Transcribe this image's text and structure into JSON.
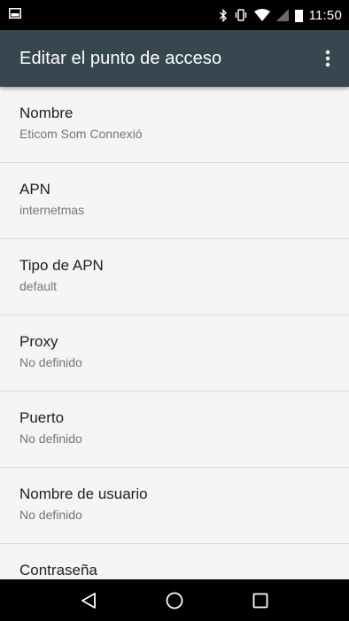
{
  "status_bar": {
    "time": "11:50",
    "icons": [
      "screenshot-icon",
      "bluetooth-icon",
      "vibrate-icon",
      "wifi-icon",
      "signal-icon",
      "battery-icon"
    ]
  },
  "app_bar": {
    "title": "Editar el punto de acceso",
    "overflow_icon": "more-vert-icon",
    "color": "#37474f"
  },
  "settings": {
    "items": [
      {
        "title": "Nombre",
        "summary": "Eticom Som Connexió"
      },
      {
        "title": "APN",
        "summary": "internetmas"
      },
      {
        "title": "Tipo de APN",
        "summary": "default"
      },
      {
        "title": "Proxy",
        "summary": "No definido"
      },
      {
        "title": "Puerto",
        "summary": "No definido"
      },
      {
        "title": "Nombre de usuario",
        "summary": "No definido"
      },
      {
        "title": "Contraseña",
        "summary": ""
      }
    ]
  },
  "nav_bar": {
    "buttons": [
      "back-icon",
      "home-icon",
      "recents-icon"
    ]
  }
}
